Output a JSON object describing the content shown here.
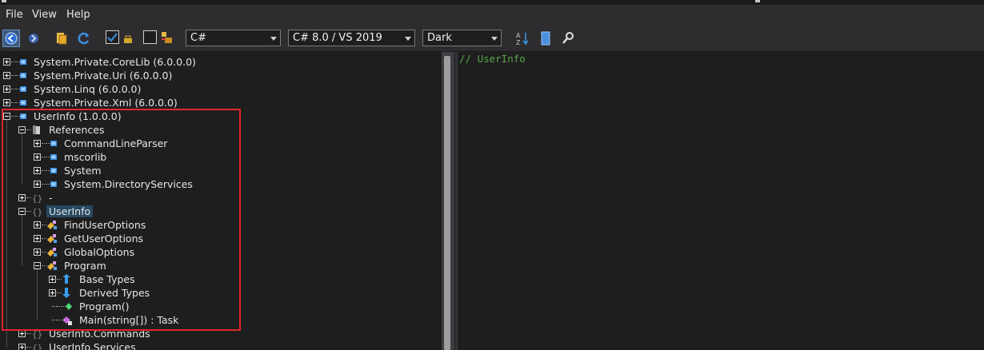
{
  "menu": {
    "items": [
      "File",
      "View",
      "Help"
    ]
  },
  "toolbar": {
    "language": "C#",
    "version": "C# 8.0 / VS 2019",
    "theme": "Dark"
  },
  "tree": {
    "items": [
      {
        "label": "System.Private.CoreLib (6.0.0.0)",
        "icon": "assembly-icon",
        "depth": 0,
        "expander": "plus"
      },
      {
        "label": "System.Private.Uri (6.0.0.0)",
        "icon": "assembly-icon",
        "depth": 0,
        "expander": "plus"
      },
      {
        "label": "System.Linq (6.0.0.0)",
        "icon": "assembly-icon",
        "depth": 0,
        "expander": "plus"
      },
      {
        "label": "System.Private.Xml (6.0.0.0)",
        "icon": "assembly-icon",
        "depth": 0,
        "expander": "plus"
      },
      {
        "label": "UserInfo (1.0.0.0)",
        "icon": "assembly-icon",
        "depth": 0,
        "expander": "minus"
      },
      {
        "label": "References",
        "icon": "references-icon",
        "depth": 1,
        "expander": "minus"
      },
      {
        "label": "CommandLineParser",
        "icon": "assembly-icon",
        "depth": 2,
        "expander": "plus"
      },
      {
        "label": "mscorlib",
        "icon": "assembly-icon",
        "depth": 2,
        "expander": "plus"
      },
      {
        "label": "System",
        "icon": "assembly-icon",
        "depth": 2,
        "expander": "plus"
      },
      {
        "label": "System.DirectoryServices",
        "icon": "assembly-icon",
        "depth": 2,
        "expander": "plus"
      },
      {
        "label": "-",
        "icon": "namespace-icon",
        "depth": 1,
        "expander": "plus"
      },
      {
        "label": "UserInfo",
        "icon": "namespace-icon",
        "depth": 1,
        "expander": "minus",
        "selected": true
      },
      {
        "label": "FindUserOptions",
        "icon": "class-icon",
        "depth": 2,
        "expander": "plus"
      },
      {
        "label": "GetUserOptions",
        "icon": "class-icon",
        "depth": 2,
        "expander": "plus"
      },
      {
        "label": "GlobalOptions",
        "icon": "class-icon",
        "depth": 2,
        "expander": "plus"
      },
      {
        "label": "Program",
        "icon": "class-icon",
        "depth": 2,
        "expander": "minus"
      },
      {
        "label": "Base Types",
        "icon": "base-types-icon",
        "depth": 3,
        "expander": "plus"
      },
      {
        "label": "Derived Types",
        "icon": "derived-types-icon",
        "depth": 3,
        "expander": "plus"
      },
      {
        "label": "Program()",
        "icon": "method-icon",
        "depth": 3,
        "expander": "none"
      },
      {
        "label": "Main(string[]) : Task",
        "icon": "static-method-icon",
        "depth": 3,
        "expander": "none"
      },
      {
        "label": "UserInfo.Commands",
        "icon": "namespace-icon",
        "depth": 1,
        "expander": "plus"
      },
      {
        "label": "UserInfo.Services",
        "icon": "namespace-icon",
        "depth": 1,
        "expander": "plus"
      }
    ]
  },
  "code": {
    "text": "// UserInfo"
  },
  "colors": {
    "highlight": "#e0262d",
    "comment": "#57a64a",
    "selection": "#26495f"
  }
}
